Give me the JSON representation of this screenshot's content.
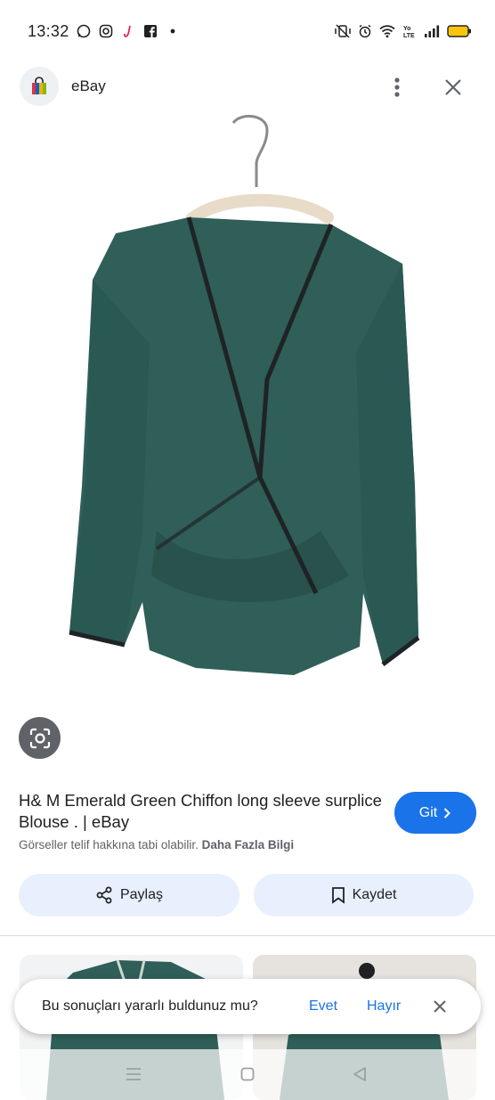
{
  "status_bar": {
    "time": "13:32",
    "left_icons": [
      "whatsapp-icon",
      "instagram-icon",
      "app-j-icon",
      "facebook-icon",
      "dot-icon"
    ],
    "right_icons": [
      "mute-vibrate-icon",
      "alarm-icon",
      "wifi-icon",
      "volte-icon",
      "signal-icon",
      "battery-icon"
    ],
    "battery_color": "#f9c50c"
  },
  "header": {
    "site_name": "eBay",
    "favicon_icon": "shopping-bag-icon",
    "more_icon": "more-vert-icon",
    "close_icon": "close-icon"
  },
  "image": {
    "icon": "blouse-on-hanger",
    "garment_color": "#2f5f58",
    "trim_color": "#1f2326"
  },
  "lens_button": {
    "icon": "lens-camera-icon"
  },
  "result": {
    "title": "H& M Emerald Green Chiffon long sleeve surplice Blouse . | eBay",
    "copyright_text": "Görseller telif hakkına tabi olabilir.",
    "more_info_label": "Daha Fazla Bilgi",
    "visit_label": "Git"
  },
  "actions": {
    "share_label": "Paylaş",
    "save_label": "Kaydet"
  },
  "feedback": {
    "question": "Bu sonuçları yararlı buldunuz mu?",
    "yes_label": "Evet",
    "no_label": "Hayır"
  },
  "colors": {
    "accent": "#1a73e8",
    "chip_bg": "#e8f0fe"
  }
}
